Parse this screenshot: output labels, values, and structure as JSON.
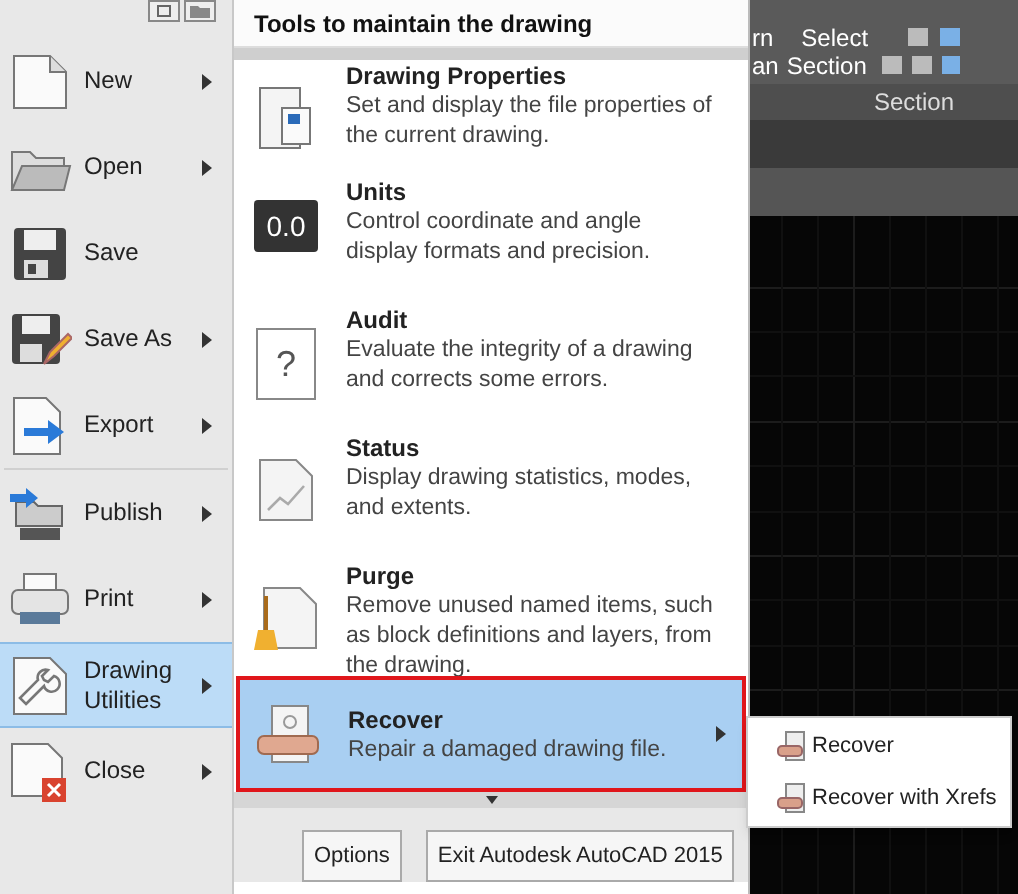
{
  "left_menu": {
    "groups": [
      {
        "items": [
          {
            "label": "New",
            "kind": "new",
            "has_submenu": true,
            "selected": false
          },
          {
            "label": "Open",
            "kind": "open",
            "has_submenu": true,
            "selected": false
          },
          {
            "label": "Save",
            "kind": "save",
            "has_submenu": false,
            "selected": false
          },
          {
            "label": "Save As",
            "kind": "saveas",
            "has_submenu": true,
            "selected": false
          },
          {
            "label": "Export",
            "kind": "export",
            "has_submenu": true,
            "selected": false
          }
        ]
      },
      {
        "items": [
          {
            "label": "Publish",
            "kind": "publish",
            "has_submenu": true,
            "selected": false
          },
          {
            "label": "Print",
            "kind": "print",
            "has_submenu": true,
            "selected": false
          },
          {
            "label": "Drawing Utilities",
            "kind": "utilities",
            "has_submenu": true,
            "selected": true
          },
          {
            "label": "Close",
            "kind": "close",
            "has_submenu": true,
            "selected": false
          }
        ]
      }
    ]
  },
  "panel": {
    "header": "Tools to maintain the drawing",
    "items": [
      {
        "title": "Drawing Properties",
        "description": "Set and display the file properties of the current drawing.",
        "kind": "properties",
        "selected": false,
        "has_submenu": false
      },
      {
        "title": "Units",
        "description": "Control coordinate and angle display formats and precision.",
        "kind": "units",
        "icon_text": "0.0",
        "selected": false,
        "has_submenu": false
      },
      {
        "title": "Audit",
        "description": "Evaluate the integrity of a drawing and corrects some errors.",
        "kind": "audit",
        "icon_text": "?",
        "selected": false,
        "has_submenu": false
      },
      {
        "title": "Status",
        "description": "Display drawing statistics, modes, and extents.",
        "kind": "status",
        "selected": false,
        "has_submenu": false
      },
      {
        "title": "Purge",
        "description": "Remove unused named items, such as block definitions and layers, from the drawing.",
        "kind": "purge",
        "selected": false,
        "has_submenu": false
      },
      {
        "title": "Recover",
        "description": "Repair a damaged drawing file.",
        "kind": "recover",
        "selected": true,
        "has_submenu": true
      }
    ],
    "buttons": [
      "Options",
      "Exit Autodesk AutoCAD 2015"
    ]
  },
  "ribbon": {
    "row_1": [
      "rn",
      "Select"
    ],
    "row_2": [
      "an",
      "Section"
    ],
    "group_label": "Section"
  },
  "submenu": {
    "items": [
      {
        "label": "Recover"
      },
      {
        "label": "Recover with Xrefs"
      }
    ]
  }
}
